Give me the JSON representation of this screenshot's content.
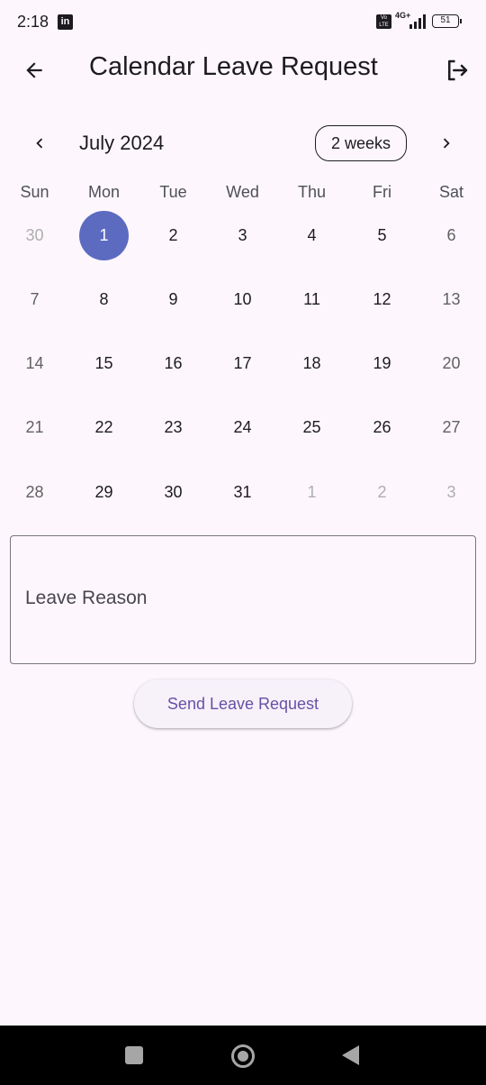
{
  "status_bar": {
    "time": "2:18",
    "app_icon": "in",
    "volte": "Vo LTE",
    "network": "4G+",
    "battery": "51"
  },
  "app_bar": {
    "title": "Calendar Leave Request",
    "back_icon": "arrow-back-icon",
    "logout_icon": "logout-icon"
  },
  "calendar": {
    "month_title": "July 2024",
    "format_button": "2 weeks",
    "weekdays": [
      "Sun",
      "Mon",
      "Tue",
      "Wed",
      "Thu",
      "Fri",
      "Sat"
    ],
    "weeks": [
      [
        "30",
        "1",
        "2",
        "3",
        "4",
        "5",
        "6"
      ],
      [
        "7",
        "8",
        "9",
        "10",
        "11",
        "12",
        "13"
      ],
      [
        "14",
        "15",
        "16",
        "17",
        "18",
        "19",
        "20"
      ],
      [
        "21",
        "22",
        "23",
        "24",
        "25",
        "26",
        "27"
      ],
      [
        "28",
        "29",
        "30",
        "31",
        "1",
        "2",
        "3"
      ]
    ],
    "selected_day": "1",
    "selected_color": "#5c6bc0"
  },
  "form": {
    "reason_placeholder": "Leave Reason",
    "reason_value": "",
    "send_label": "Send Leave Request",
    "accent_color": "#6750a4"
  }
}
